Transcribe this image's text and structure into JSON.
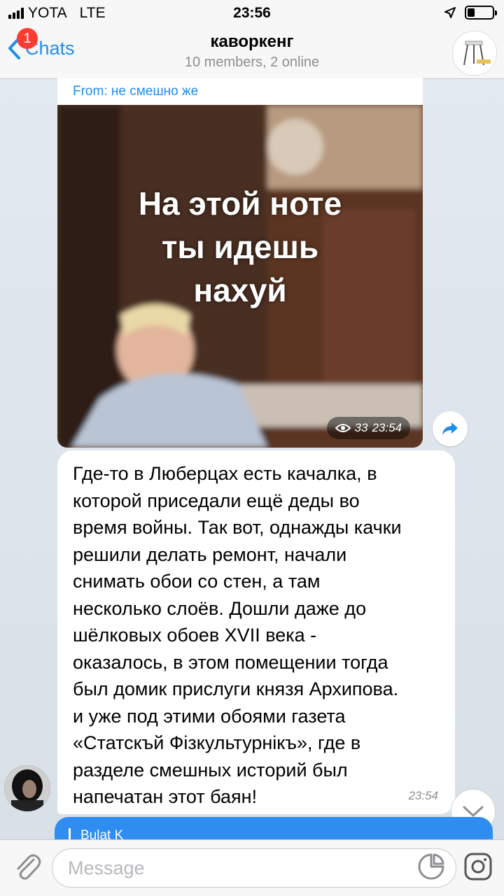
{
  "status_bar": {
    "carrier": "YOTA",
    "network": "LTE",
    "time": "23:56",
    "battery_level": 0.3
  },
  "header": {
    "back_label": "Chats",
    "unread_badge": "1",
    "title": "каворкенг",
    "subtitle": "10 members, 2 online",
    "avatar_icon": "stool-icon"
  },
  "messages": [
    {
      "type": "forwarded-photo",
      "forwarded_from": "From: не смешно же",
      "photo_caption": "На этой ноте\nты идешь\nнахуй",
      "views": "33",
      "time": "23:54"
    },
    {
      "type": "text",
      "text": "Где-то в Люберцах есть качалка, в\nкоторой приседали ещё деды во\nвремя войны. Так вот, однажды качки\nрешили делать ремонт, начали\nснимать обои со стен, а там\nнесколько слоёв. Дошли даже до\nшёлковых обоев XVII века -\nоказалось, в этом помещении тогда\nбыл домик прислуги князя Архипова.\nи уже под этими обоями газета\n«Статскъй Фізкультурнікъ», где в\nразделе смешных историй был\nнапечатан этот баян!",
      "time": "23:54"
    },
    {
      "type": "outgoing-partial",
      "reply_name": "Bulat K"
    }
  ],
  "input": {
    "placeholder": "Message"
  },
  "colors": {
    "accent": "#1f8ded",
    "badge": "#fe3b30",
    "outgoing_bubble": "#2f8cf0"
  }
}
